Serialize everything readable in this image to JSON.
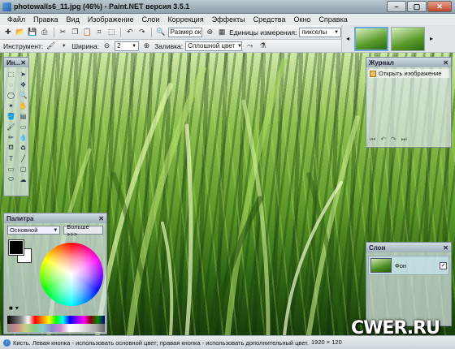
{
  "window": {
    "title": "photowalls6_11.jpg (46%) - Paint.NET версия 3.5.1"
  },
  "menu": [
    "Файл",
    "Правка",
    "Вид",
    "Изображение",
    "Слои",
    "Коррекция",
    "Эффекты",
    "Средства",
    "Окно",
    "Справка"
  ],
  "toolbar": {
    "zoom_value": "Размер ок",
    "units_label": "Единицы измерения:",
    "units_value": "пикселы",
    "tool_label": "Инструмент:",
    "width_label": "Ширина:",
    "width_value": "2",
    "fill_label": "Заливка:",
    "fill_value": "Сплошной цвет"
  },
  "tools_panel": {
    "title": "Ин..."
  },
  "palette": {
    "title": "Палитра",
    "mode": "Основной",
    "more_button": "Больше >>>",
    "primary_color": "#000000",
    "secondary_color": "#ffffff"
  },
  "history": {
    "title": "Журнал",
    "items": [
      "Открыть изображение"
    ]
  },
  "layers": {
    "title": "Слои",
    "items": [
      {
        "name": "Фон",
        "visible": true
      }
    ]
  },
  "status": {
    "text": "Кисть. Левая кнопка - использовать основной цвет; правая кнопка - использовать дополнительный цвет.",
    "dimensions": "1920 × 120"
  },
  "watermark": "CWER.RU"
}
